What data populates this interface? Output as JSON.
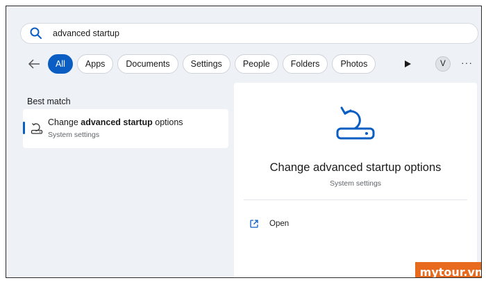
{
  "search": {
    "query": "advanced startup",
    "icon": "search-icon"
  },
  "filters": {
    "back_icon": "back-arrow-icon",
    "chips": [
      "All",
      "Apps",
      "Documents",
      "Settings",
      "People",
      "Folders",
      "Photos"
    ],
    "active": "All"
  },
  "header": {
    "more_icon": "play-arrow-icon",
    "avatar_initial": "V",
    "menu_icon": "ellipsis-icon",
    "menu_text": "···"
  },
  "results": {
    "section_title": "Best match",
    "items": [
      {
        "title_prefix": "Change ",
        "title_bold": "advanced startup",
        "title_suffix": " options",
        "subtitle": "System settings",
        "icon": "recovery-icon"
      }
    ]
  },
  "detail": {
    "icon": "recovery-icon",
    "title": "Change advanced startup options",
    "subtitle": "System settings",
    "actions": [
      {
        "label": "Open",
        "icon": "open-external-icon"
      }
    ]
  },
  "watermark": "mytour.vn",
  "colors": {
    "accent": "#0a5dc2",
    "panel_bg": "#eef1f6",
    "watermark_bg": "#e86a1f",
    "icon_blue": "#0a5dc2"
  }
}
